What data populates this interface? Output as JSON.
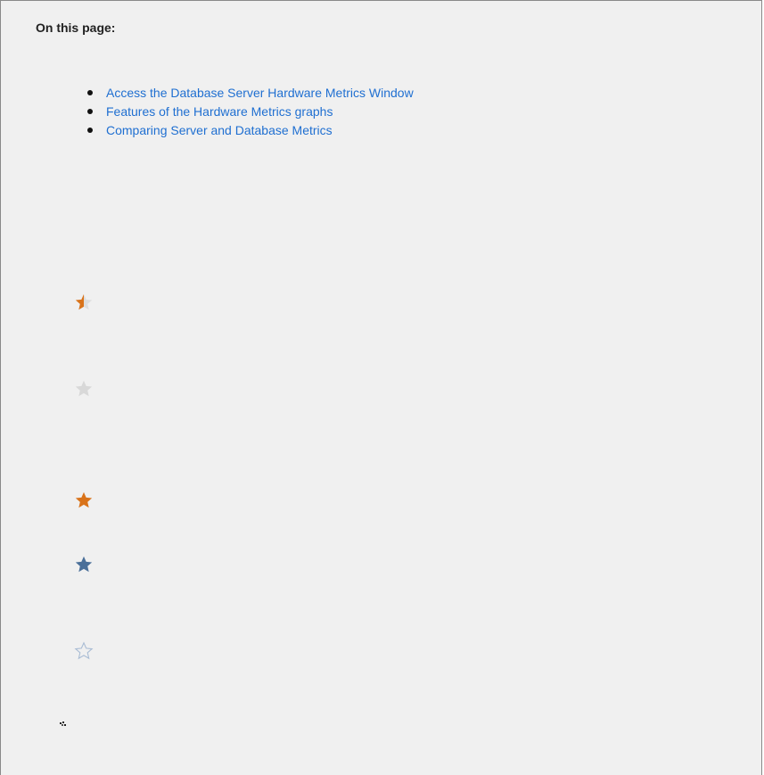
{
  "panel": {
    "title": "On this page:",
    "toc_items": [
      {
        "label": "Access the Database Server Hardware Metrics Window"
      },
      {
        "label": "Features of the Hardware Metrics graphs"
      },
      {
        "label": "Comparing Server and Database Metrics"
      }
    ]
  },
  "icons": [
    {
      "name": "half-star-icon",
      "color": "#d9731a",
      "empty_color": "#dddddd"
    },
    {
      "name": "grey-star-icon",
      "color": "#d8d8d8"
    },
    {
      "name": "orange-star-icon",
      "color": "#d9731a"
    },
    {
      "name": "blue-star-icon",
      "color": "#4a6f99"
    },
    {
      "name": "outline-star-icon",
      "color": "#a9bcd4"
    }
  ]
}
